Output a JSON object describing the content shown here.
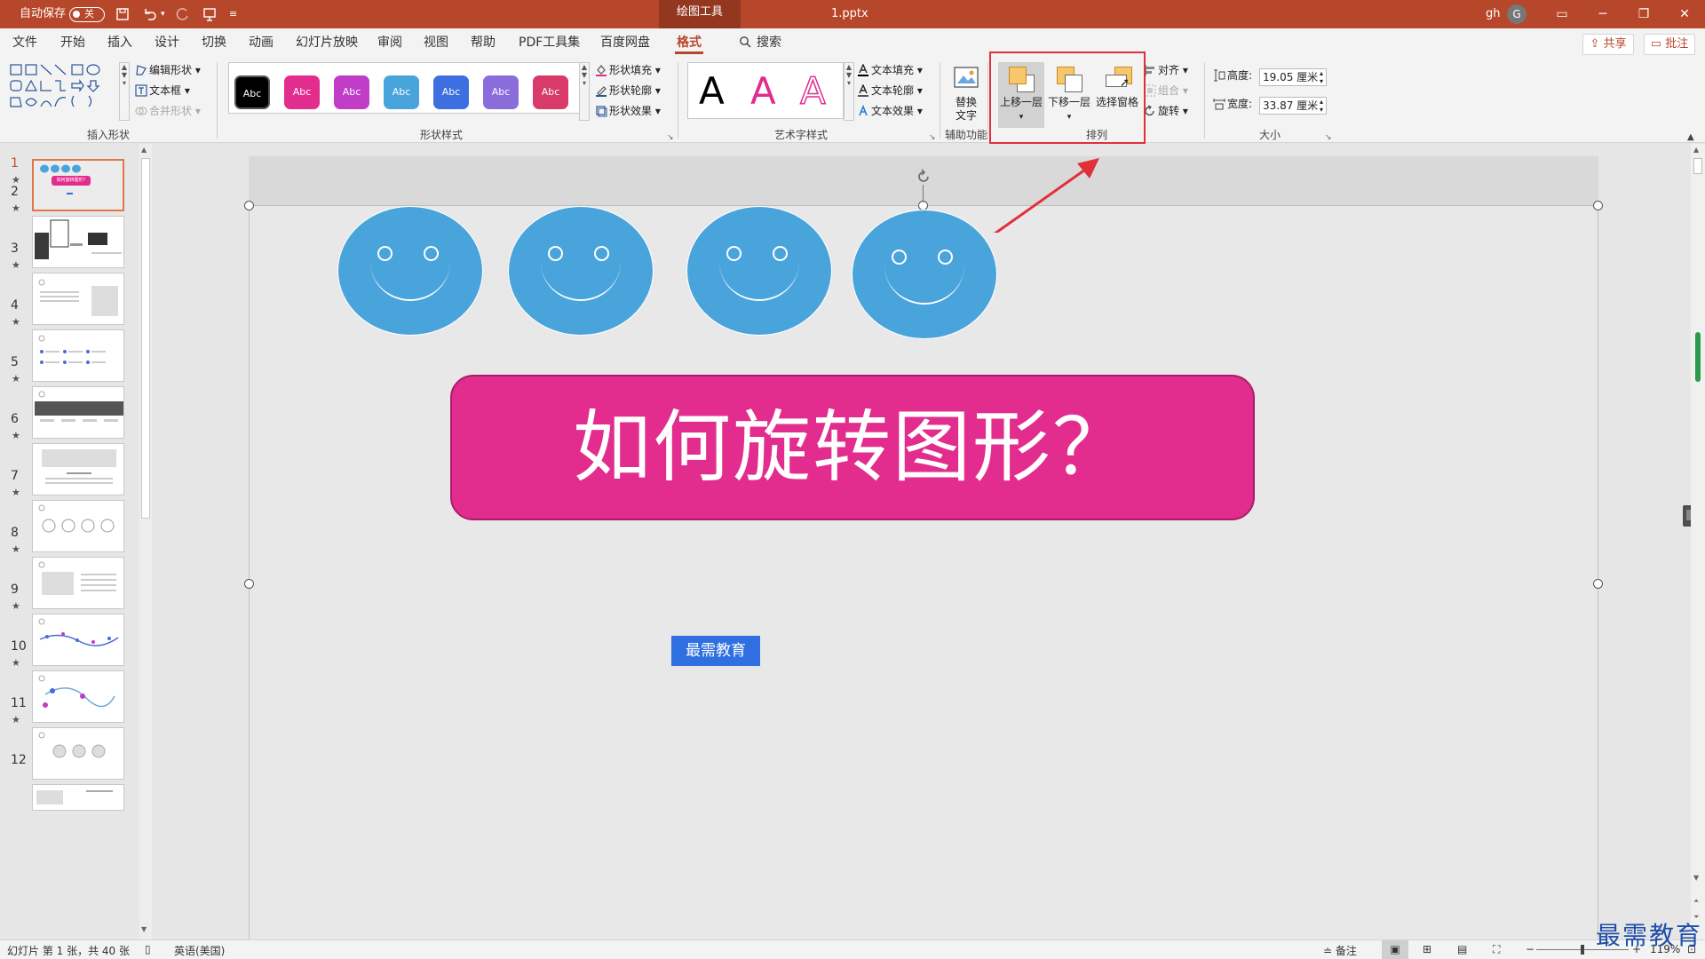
{
  "titlebar": {
    "autosave_label": "自动保存",
    "autosave_state": "关",
    "context_tab": "绘图工具",
    "file_name": "1.pptx",
    "user_name": "gh",
    "user_initial": "G"
  },
  "tabs": [
    "文件",
    "开始",
    "插入",
    "设计",
    "切换",
    "动画",
    "幻灯片放映",
    "审阅",
    "视图",
    "帮助",
    "PDF工具集",
    "百度网盘",
    "格式"
  ],
  "active_tab": "格式",
  "search_label": "搜索",
  "share_label": "共享",
  "comment_label": "批注",
  "ribbon": {
    "insert_shapes": {
      "label": "插入形状",
      "edit_shape": "编辑形状",
      "text_box": "文本框",
      "merge_shapes": "合并形状"
    },
    "shape_styles": {
      "label": "形状样式",
      "swatch_text": "Abc",
      "fill": "形状填充",
      "outline": "形状轮廓",
      "effects": "形状效果",
      "swatch_colors": [
        "#000000",
        "#e22d8e",
        "#c13dc8",
        "#4aa4dc",
        "#3e6fe0",
        "#8a6ddb",
        "#d83a6a"
      ]
    },
    "wordart": {
      "label": "艺术字样式",
      "letter": "A",
      "text_fill": "文本填充",
      "text_outline": "文本轮廓",
      "text_effects": "文本效果"
    },
    "accessibility": {
      "label": "辅助功能",
      "alt_text": "替换文字"
    },
    "arrange": {
      "label": "排列",
      "bring_forward": "上移一层",
      "send_backward": "下移一层",
      "selection_pane": "选择窗格",
      "align": "对齐",
      "group": "组合",
      "rotate": "旋转"
    },
    "size": {
      "label": "大小",
      "height_label": "高度:",
      "height_value": "19.05 厘米",
      "width_label": "宽度:",
      "width_value": "33.87 厘米"
    }
  },
  "thumbnails": [
    "1",
    "2",
    "3",
    "4",
    "5",
    "6",
    "7",
    "8",
    "9",
    "10",
    "11",
    "12"
  ],
  "thumb_star": "★",
  "thumb1_title": "如何旋转图形？",
  "slide": {
    "title": "如何旋转图形？",
    "button": "最需教育",
    "accent_pink": "#e22d8e",
    "face_blue": "#4aa4dc"
  },
  "statusbar": {
    "slide_info": "幻灯片 第 1 张，共 40 张",
    "language": "英语(美国)",
    "notes": "备注",
    "zoom": "119%"
  },
  "brand_watermark": "最需教育"
}
